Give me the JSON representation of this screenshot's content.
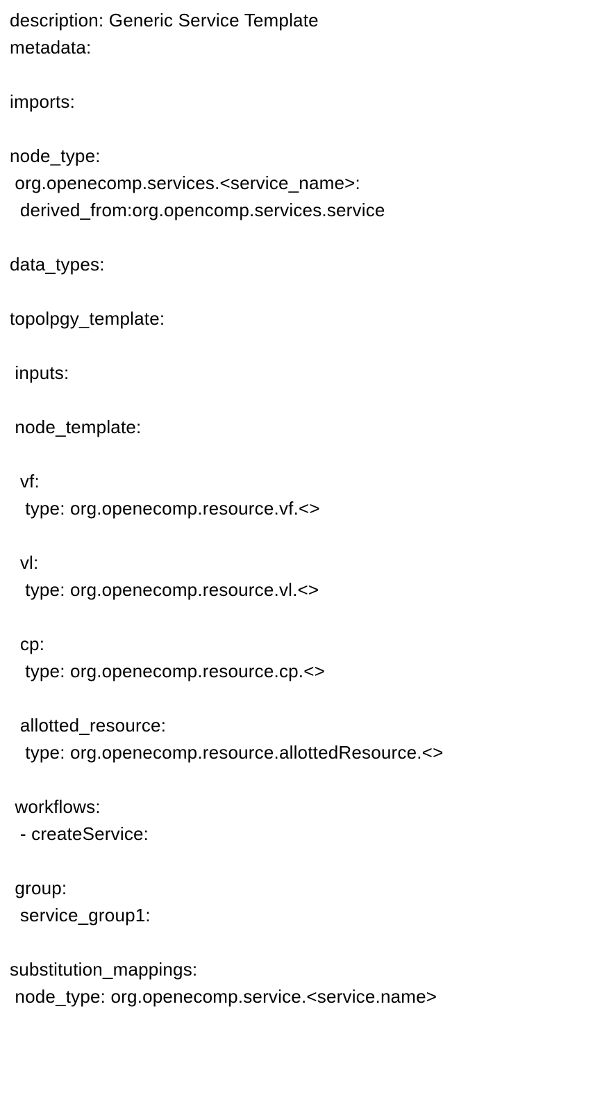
{
  "lines": [
    {
      "indent": 0,
      "text": "description: Generic Service Template"
    },
    {
      "indent": 0,
      "text": "metadata:"
    },
    {
      "blank": true
    },
    {
      "indent": 0,
      "text": "imports:"
    },
    {
      "blank": true
    },
    {
      "indent": 0,
      "text": "node_type:"
    },
    {
      "indent": 1,
      "text": "org.openecomp.services.<service_name>:"
    },
    {
      "indent": 2,
      "text": "derived_from:org.opencomp.services.service"
    },
    {
      "blank": true
    },
    {
      "indent": 0,
      "text": "data_types:"
    },
    {
      "blank": true
    },
    {
      "indent": 0,
      "text": "topolpgy_template:"
    },
    {
      "blank": true
    },
    {
      "indent": 1,
      "text": "inputs:"
    },
    {
      "blank": true
    },
    {
      "indent": 1,
      "text": "node_template:"
    },
    {
      "blank": true
    },
    {
      "indent": 2,
      "text": "vf:"
    },
    {
      "indent": 3,
      "text": "type: org.openecomp.resource.vf.<>"
    },
    {
      "blank": true
    },
    {
      "indent": 2,
      "text": "vl:"
    },
    {
      "indent": 3,
      "text": "type: org.openecomp.resource.vl.<>"
    },
    {
      "blank": true
    },
    {
      "indent": 2,
      "text": "cp:"
    },
    {
      "indent": 3,
      "text": "type: org.openecomp.resource.cp.<>"
    },
    {
      "blank": true
    },
    {
      "indent": 2,
      "text": "allotted_resource:"
    },
    {
      "indent": 3,
      "text": "type: org.openecomp.resource.allottedResource.<>"
    },
    {
      "blank": true
    },
    {
      "indent": 1,
      "text": "workflows:"
    },
    {
      "indent": 2,
      "text": "- createService:"
    },
    {
      "blank": true
    },
    {
      "indent": 1,
      "text": "group:"
    },
    {
      "indent": 2,
      "text": "service_group1:"
    },
    {
      "blank": true
    },
    {
      "indent": 0,
      "text": "substitution_mappings:"
    },
    {
      "indent": 1,
      "text": "node_type: org.openecomp.service.<service.name>"
    }
  ]
}
